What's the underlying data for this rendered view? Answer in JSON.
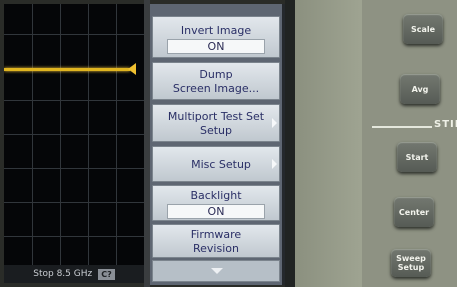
{
  "display": {
    "status_text": "Stop 8.5 GHz",
    "status_chip": "C?"
  },
  "menu": {
    "invert_image": {
      "label": "Invert Image",
      "value": "ON"
    },
    "dump_screen": {
      "line1": "Dump",
      "line2": "Screen Image..."
    },
    "multiport": {
      "line1": "Multiport Test Set",
      "line2": "Setup"
    },
    "misc_setup": {
      "label": "Misc Setup"
    },
    "backlight": {
      "label": "Backlight",
      "value": "ON"
    },
    "firmware": {
      "line1": "Firmware",
      "line2": "Revision"
    }
  },
  "front_panel": {
    "scale": "Scale",
    "avg": "Avg",
    "stim_group": "STIM",
    "start": "Start",
    "center": "Center",
    "sweep_setup": "Sweep Setup"
  },
  "colors": {
    "trace": "#e0b520",
    "softkey_text": "#2a2f66",
    "panel": "#9ea391"
  }
}
